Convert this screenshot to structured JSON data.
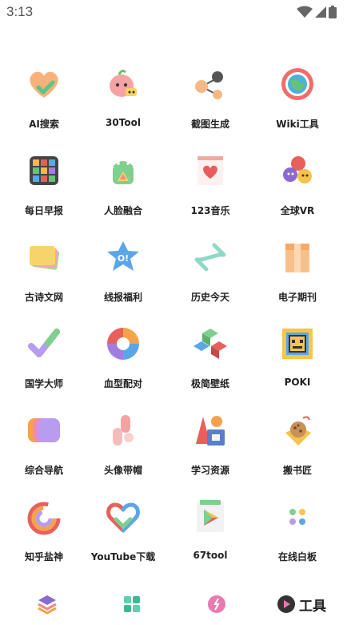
{
  "status": {
    "time": "3:13"
  },
  "tools": [
    {
      "label": "AI搜索",
      "icon": "heart-check-icon"
    },
    {
      "label": "30Tool",
      "icon": "peach-mascot-icon"
    },
    {
      "label": "截图生成",
      "icon": "share-nodes-icon"
    },
    {
      "label": "Wiki工具",
      "icon": "globe-icon"
    },
    {
      "label": "每日早报",
      "icon": "rubik-cube-icon"
    },
    {
      "label": "人脸融合",
      "icon": "android-robot-icon"
    },
    {
      "label": "123音乐",
      "icon": "heart-card-icon"
    },
    {
      "label": "全球VR",
      "icon": "cute-balls-icon"
    },
    {
      "label": "古诗文网",
      "icon": "stacked-cards-icon"
    },
    {
      "label": "线报福利",
      "icon": "star-badge-icon"
    },
    {
      "label": "历史今天",
      "icon": "link-arrows-icon"
    },
    {
      "label": "电子期刊",
      "icon": "package-box-icon"
    },
    {
      "label": "国学大师",
      "icon": "checkmark-icon"
    },
    {
      "label": "血型配对",
      "icon": "color-ring-icon"
    },
    {
      "label": "极简壁纸",
      "icon": "cubes-icon"
    },
    {
      "label": "POKI",
      "icon": "game-face-icon"
    },
    {
      "label": "综合导航",
      "icon": "gradient-cards-icon"
    },
    {
      "label": "头像带帽",
      "icon": "pink-blocks-icon"
    },
    {
      "label": "学习资源",
      "icon": "shapes-icon"
    },
    {
      "label": "搬书匠",
      "icon": "cookie-icon"
    },
    {
      "label": "知乎盐神",
      "icon": "rainbow-swirl-icon"
    },
    {
      "label": "YouTube下载",
      "icon": "rainbow-heart-icon"
    },
    {
      "label": "67tool",
      "icon": "play-store-icon"
    },
    {
      "label": "在线白板",
      "icon": "dots-icon"
    }
  ],
  "nav": [
    {
      "label": "",
      "icon": "layers-icon"
    },
    {
      "label": "",
      "icon": "puzzle-icon"
    },
    {
      "label": "",
      "icon": "compass-icon"
    },
    {
      "label": "工具",
      "icon": "tools-icon"
    }
  ],
  "colors": {
    "background": "#ffffff",
    "text": "#222222"
  }
}
